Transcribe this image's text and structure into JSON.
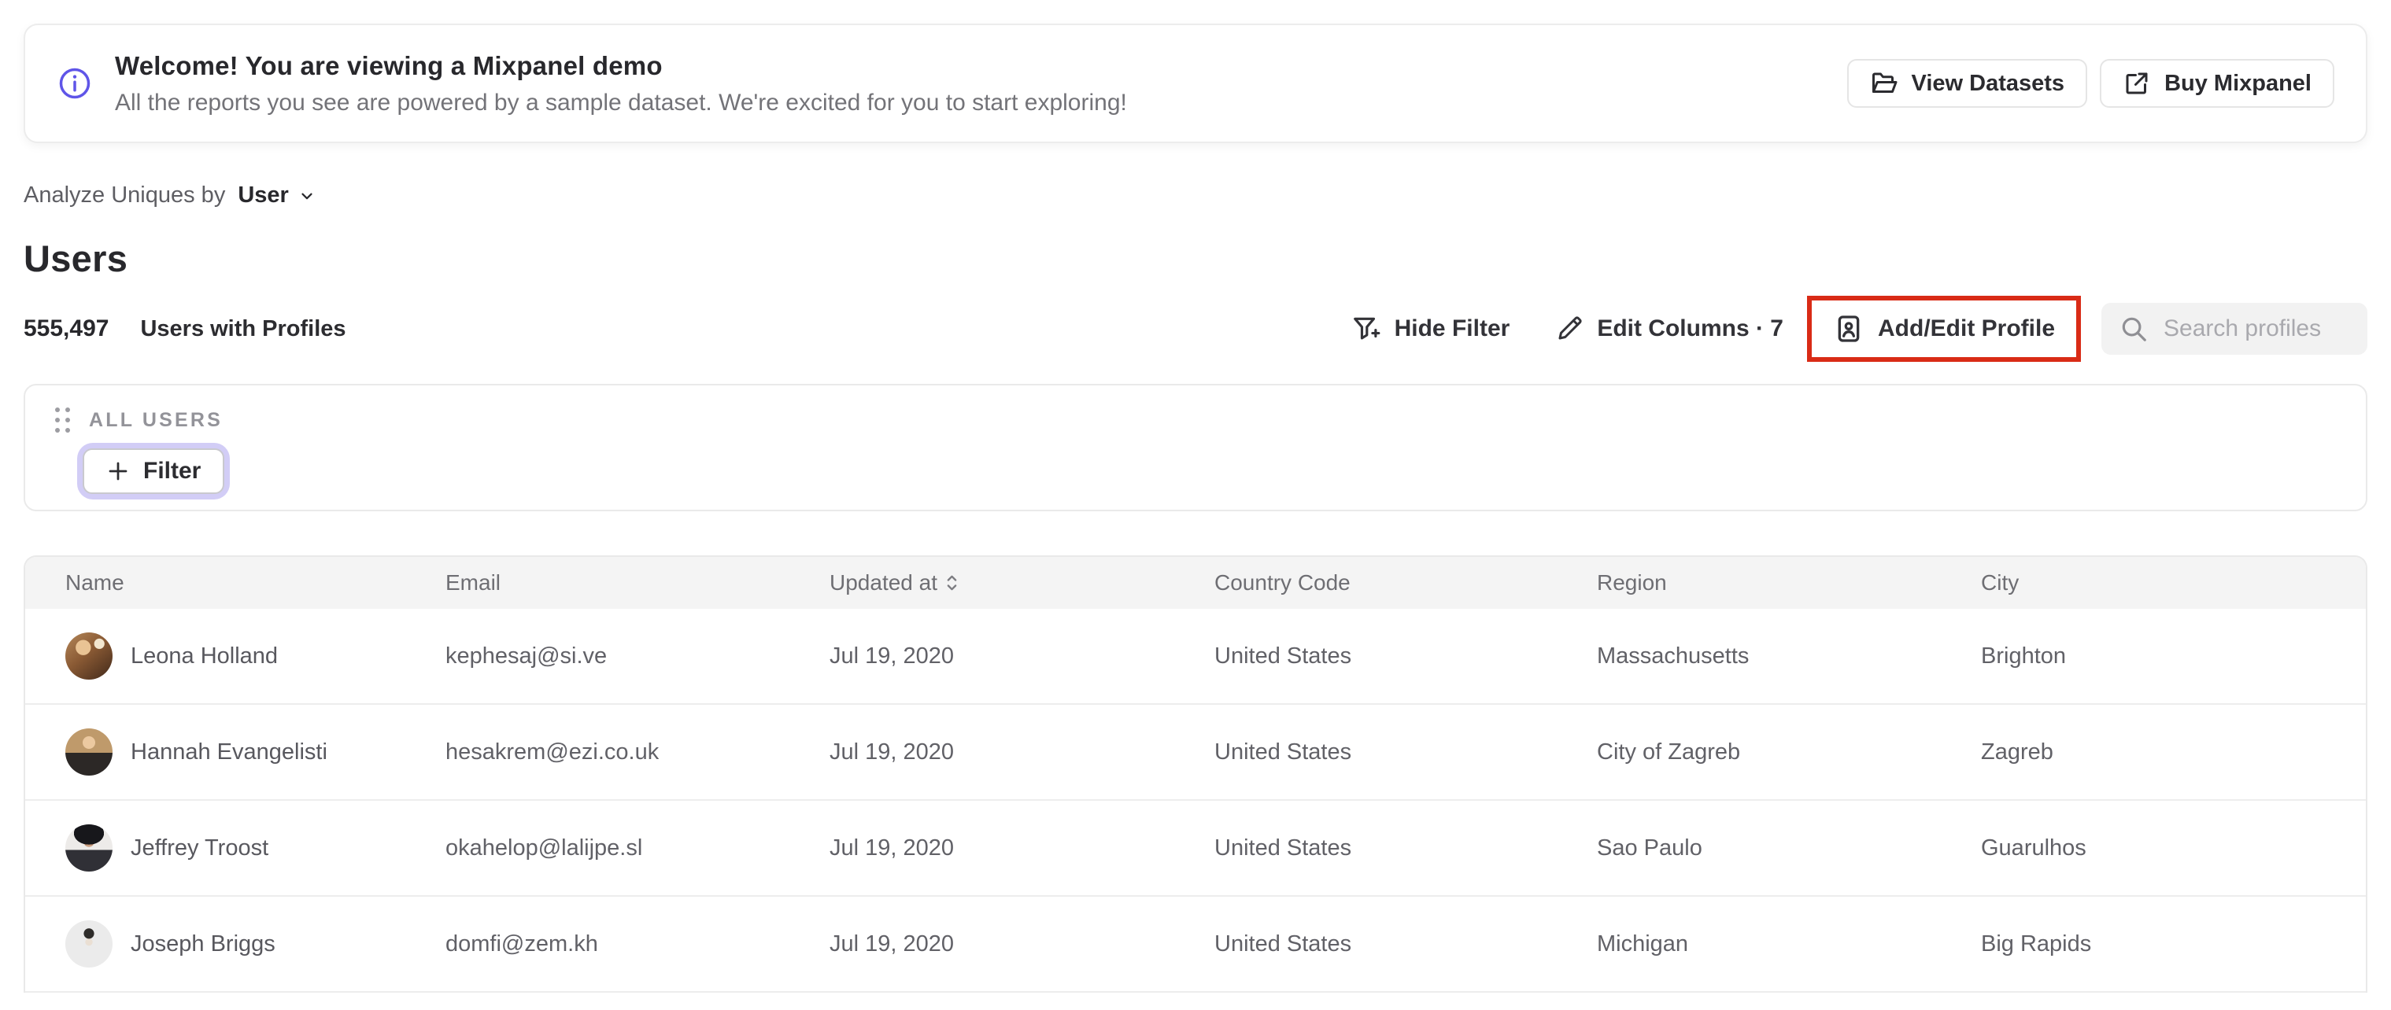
{
  "banner": {
    "title": "Welcome! You are viewing a Mixpanel demo",
    "subtitle": "All the reports you see are powered by a sample dataset. We're excited for you to start exploring!",
    "view_datasets_label": "View Datasets",
    "buy_mixpanel_label": "Buy Mixpanel"
  },
  "controls": {
    "analyze_prefix": "Analyze Uniques by",
    "analyze_selected": "User"
  },
  "page": {
    "title": "Users"
  },
  "summary": {
    "count": "555,497",
    "label": "Users with Profiles"
  },
  "toolbar": {
    "hide_filter": "Hide Filter",
    "edit_columns": "Edit Columns · 7",
    "add_edit_profile": "Add/Edit Profile",
    "search_placeholder": "Search profiles"
  },
  "filter_panel": {
    "group_label": "ALL USERS",
    "add_filter": "Filter"
  },
  "table": {
    "columns": [
      "Name",
      "Email",
      "Updated at",
      "Country Code",
      "Region",
      "City"
    ],
    "rows": [
      {
        "name": "Leona Holland",
        "email": "kephesaj@si.ve",
        "updated_at": "Jul 19, 2020",
        "country": "United States",
        "region": "Massachusetts",
        "city": "Brighton"
      },
      {
        "name": "Hannah Evangelisti",
        "email": "hesakrem@ezi.co.uk",
        "updated_at": "Jul 19, 2020",
        "country": "United States",
        "region": "City of Zagreb",
        "city": "Zagreb"
      },
      {
        "name": "Jeffrey Troost",
        "email": "okahelop@lalijpe.sl",
        "updated_at": "Jul 19, 2020",
        "country": "United States",
        "region": "Sao Paulo",
        "city": "Guarulhos"
      },
      {
        "name": "Joseph Briggs",
        "email": "domfi@zem.kh",
        "updated_at": "Jul 19, 2020",
        "country": "United States",
        "region": "Michigan",
        "city": "Big Rapids"
      }
    ]
  },
  "colors": {
    "info_accent": "#5f55e8",
    "annotation_red": "#d92b16",
    "filter_focus_ring": "#d2cdf6"
  }
}
